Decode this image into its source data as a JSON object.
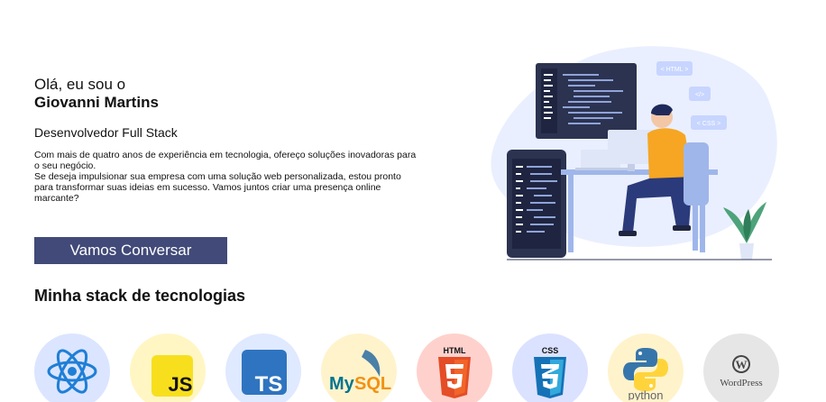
{
  "hero": {
    "greeting": "Olá, eu sou o",
    "name": "Giovanni Martins",
    "role": "Desenvolvedor Full Stack",
    "bio_line1": "Com mais de quatro anos de experiência em tecnologia, ofereço soluções inovadoras para o seu negócio.",
    "bio_line2": "Se deseja impulsionar sua empresa com uma solução web personalizada, estou pronto para transformar suas ideias em sucesso. Vamos juntos criar uma presença online marcante?",
    "cta_label": "Vamos Conversar"
  },
  "illustration": {
    "tags": [
      "< HTML >",
      "</>",
      "< CSS >"
    ]
  },
  "stack": {
    "title": "Minha stack de tecnologias",
    "items": [
      {
        "name": "React",
        "icon": "react-icon",
        "bg": "#dbe5ff"
      },
      {
        "name": "JS",
        "icon": "javascript-icon",
        "bg": "#fff6c4"
      },
      {
        "name": "TS",
        "icon": "typescript-icon",
        "bg": "#dfe9ff"
      },
      {
        "name": "MySQL",
        "icon": "mysql-icon",
        "bg": "#fff3cc"
      },
      {
        "name": "HTML",
        "icon": "html5-icon",
        "bg": "#ffd1cc"
      },
      {
        "name": "CSS",
        "icon": "css3-icon",
        "bg": "#dbe2ff"
      },
      {
        "name": "python",
        "icon": "python-icon",
        "bg": "#fff3cc"
      },
      {
        "name": "WordPress",
        "icon": "wordpress-icon",
        "bg": "#e6e6e6"
      }
    ]
  },
  "colors": {
    "cta_bg": "#414a78",
    "illustration_blob": "#e9efff",
    "shirt": "#f6a623",
    "monitor": "#2c3350"
  }
}
